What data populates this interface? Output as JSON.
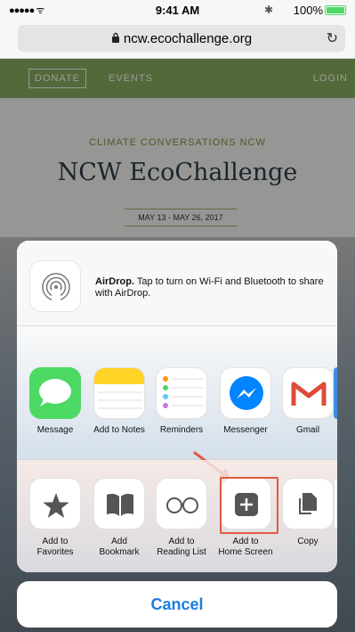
{
  "status_bar": {
    "time": "9:41 AM",
    "battery": "100%",
    "battery_level": 1.0,
    "signal_icon": "signal-dots-icon",
    "wifi_icon": "wifi-icon",
    "bluetooth_icon": "bluetooth-icon"
  },
  "address_bar": {
    "url": "ncw.ecochallenge.org",
    "lock_icon": "lock-icon",
    "reload_icon": "reload-icon"
  },
  "page": {
    "nav": {
      "donate": "DONATE",
      "events": "EVENTS",
      "login": "LOGIN"
    },
    "eyebrow": "CLIMATE CONVERSATIONS NCW",
    "headline": "NCW EcoChallenge",
    "dates": "MAY 13 - MAY 26, 2017",
    "brand_color": "#8db061"
  },
  "share_sheet": {
    "airdrop": {
      "title": "AirDrop.",
      "description": "Tap to turn on Wi-Fi and Bluetooth to share with AirDrop."
    },
    "apps": [
      {
        "label": "Message",
        "icon": "messages-icon",
        "color": "#4cd964"
      },
      {
        "label": "Add to Notes",
        "icon": "notes-icon",
        "color": "#ffd426"
      },
      {
        "label": "Reminders",
        "icon": "reminders-icon",
        "color": "#ffffff"
      },
      {
        "label": "Messenger",
        "icon": "messenger-icon",
        "color": "#0084ff"
      },
      {
        "label": "Gmail",
        "icon": "gmail-icon",
        "color": "#dd4b39"
      }
    ],
    "actions": [
      {
        "label_line1": "Add to",
        "label_line2": "Favorites",
        "icon": "star-icon"
      },
      {
        "label_line1": "Add",
        "label_line2": "Bookmark",
        "icon": "book-icon"
      },
      {
        "label_line1": "Add to",
        "label_line2": "Reading List",
        "icon": "glasses-icon"
      },
      {
        "label_line1": "Add to",
        "label_line2": "Home Screen",
        "icon": "plus-square-icon"
      },
      {
        "label_line1": "Copy",
        "label_line2": "",
        "icon": "copy-icon"
      }
    ],
    "highlight_color": "#e05a40"
  },
  "cancel": "Cancel",
  "accent_color": "#1a7ddf"
}
